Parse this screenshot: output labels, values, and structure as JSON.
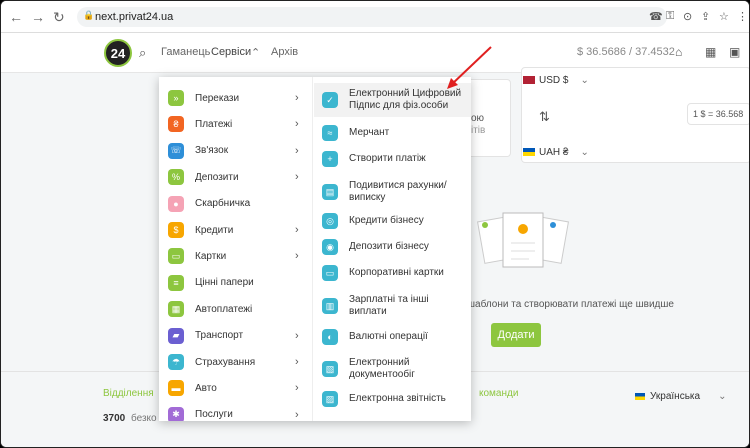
{
  "browser": {
    "url": "next.privat24.ua"
  },
  "header": {
    "logo": "24",
    "nav": [
      "Гаманець",
      "Сервіси",
      "Архів"
    ],
    "rate": "$ 36.5686 / 37.4532"
  },
  "background": {
    "card_text": "ою",
    "card_text2": "ітів",
    "conv_usd": "USD $",
    "conv_uah": "UAH ₴",
    "conv_rate": "1 $ = 36.568",
    "templates_text": "шаблони та створювати платежі ще швидше",
    "add_button": "Додати",
    "footer_branches": "Відділення",
    "footer_phone": "3700",
    "footer_free": "безко",
    "footer_commands": "команди",
    "footer_lang": "Українська"
  },
  "menu": {
    "left": [
      {
        "label": "Перекази",
        "icon": "transfer-icon",
        "color": "#8dc63f",
        "arrow": true
      },
      {
        "label": "Платежі",
        "icon": "payment-icon",
        "color": "#f26522",
        "arrow": true
      },
      {
        "label": "Зв'язок",
        "icon": "phone-icon",
        "color": "#2e8fd8",
        "arrow": true
      },
      {
        "label": "Депозити",
        "icon": "percent-icon",
        "color": "#8dc63f",
        "arrow": true
      },
      {
        "label": "Скарбничка",
        "icon": "piggy-bank-icon",
        "color": "#f5a3b5",
        "arrow": false
      },
      {
        "label": "Кредити",
        "icon": "credit-icon",
        "color": "#f7a600",
        "arrow": true
      },
      {
        "label": "Картки",
        "icon": "card-icon",
        "color": "#8dc63f",
        "arrow": true
      },
      {
        "label": "Цінні папери",
        "icon": "securities-icon",
        "color": "#8dc63f",
        "arrow": false
      },
      {
        "label": "Автоплатежі",
        "icon": "calendar-icon",
        "color": "#8dc63f",
        "arrow": false
      },
      {
        "label": "Транспорт",
        "icon": "transport-icon",
        "color": "#6b5fd1",
        "arrow": true
      },
      {
        "label": "Страхування",
        "icon": "umbrella-icon",
        "color": "#3cb6cf",
        "arrow": true
      },
      {
        "label": "Авто",
        "icon": "car-icon",
        "color": "#f7a600",
        "arrow": true
      },
      {
        "label": "Послуги",
        "icon": "services-icon",
        "color": "#a26bd6",
        "arrow": true
      }
    ],
    "right": [
      {
        "label": "Електронний Цифровий Підпис для фіз.особи",
        "icon": "signature-icon"
      },
      {
        "label": "Мерчант",
        "icon": "merchant-icon"
      },
      {
        "label": "Створити платіж",
        "icon": "plus-icon"
      },
      {
        "label": "Подивитися рахунки/ виписку",
        "icon": "statement-icon"
      },
      {
        "label": "Кредити бізнесу",
        "icon": "business-credit-icon"
      },
      {
        "label": "Депозити бізнесу",
        "icon": "business-deposit-icon"
      },
      {
        "label": "Корпоративні картки",
        "icon": "corporate-card-icon"
      },
      {
        "label": "Зарплатні та інші виплати",
        "icon": "salary-icon"
      },
      {
        "label": "Валютні операції",
        "icon": "currency-icon"
      },
      {
        "label": "Електронний документообіг",
        "icon": "document-flow-icon"
      },
      {
        "label": "Електронна звітність",
        "icon": "reporting-icon"
      }
    ]
  }
}
